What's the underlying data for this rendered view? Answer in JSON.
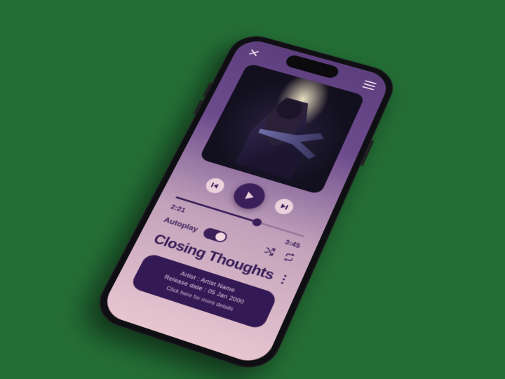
{
  "player": {
    "elapsed": "2:21",
    "total": "3:45",
    "autoplay_label": "Autoplay",
    "song_title": "Closing Thoughts",
    "artist_line": "Artist : Artist Name",
    "release_line": "Release date : 05 Jan 2000",
    "more_cta": "Click here for more details"
  }
}
